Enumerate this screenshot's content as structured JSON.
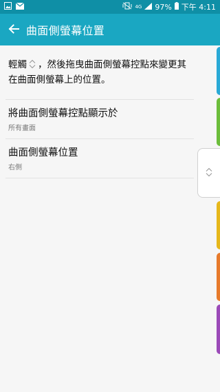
{
  "status_bar": {
    "network": "4G",
    "battery": "97%",
    "time": "下午 4:11"
  },
  "app_bar": {
    "title": "曲面側螢幕位置"
  },
  "description": {
    "before_icon": "輕觸",
    "after_icon": "，然後拖曳曲面側螢幕控點來變更其在曲面側螢幕上的位置。"
  },
  "settings": [
    {
      "title": "將曲面側螢幕控點顯示於",
      "value": "所有畫面"
    },
    {
      "title": "曲面側螢幕位置",
      "value": "右側"
    }
  ],
  "colors": {
    "status_bar": "#0f8fa6",
    "app_bar": "#1aa7c2",
    "edge_tabs": [
      "#29a9d6",
      "#6cbd3b",
      "#e6b71b",
      "#e77a2b",
      "#9b4ab8"
    ]
  }
}
